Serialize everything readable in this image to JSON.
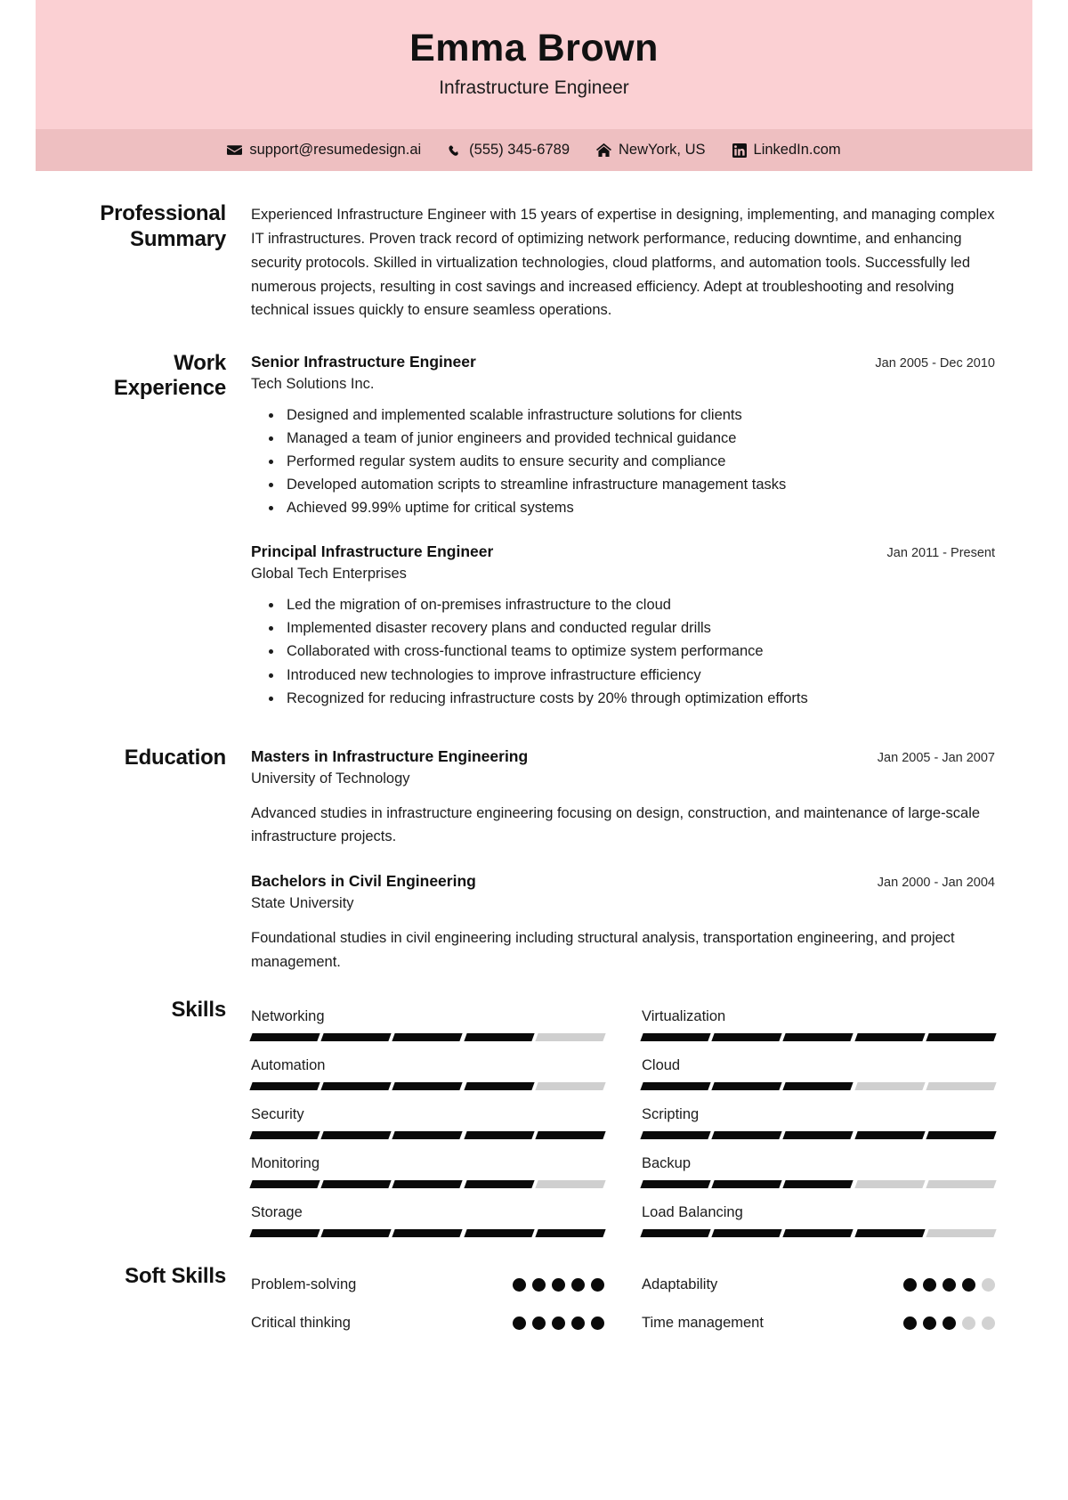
{
  "header": {
    "name": "Emma Brown",
    "job_title": "Infrastructure Engineer",
    "bg_color": "#fbd0d3",
    "contactbar_color": "#eebfc1",
    "contacts": [
      {
        "icon": "envelope-icon",
        "text": "support@resumedesign.ai"
      },
      {
        "icon": "phone-icon",
        "text": "(555) 345-6789"
      },
      {
        "icon": "home-icon",
        "text": "NewYork, US"
      },
      {
        "icon": "linkedin-icon",
        "text": "LinkedIn.com"
      }
    ]
  },
  "summary": {
    "label": "Professional Summary",
    "text": "Experienced Infrastructure Engineer with 15 years of expertise in designing, implementing, and managing complex IT infrastructures. Proven track record of optimizing network performance, reducing downtime, and enhancing security protocols. Skilled in virtualization technologies, cloud platforms, and automation tools. Successfully led numerous projects, resulting in cost savings and increased efficiency. Adept at troubleshooting and resolving technical issues quickly to ensure seamless operations."
  },
  "work": {
    "label": "Work Experience",
    "entries": [
      {
        "role": "Senior Infrastructure Engineer",
        "org": "Tech Solutions Inc.",
        "date": "Jan 2005 - Dec 2010",
        "bullets": [
          "Designed and implemented scalable infrastructure solutions for clients",
          "Managed a team of junior engineers and provided technical guidance",
          "Performed regular system audits to ensure security and compliance",
          "Developed automation scripts to streamline infrastructure management tasks",
          "Achieved 99.99% uptime for critical systems"
        ]
      },
      {
        "role": "Principal Infrastructure Engineer",
        "org": "Global Tech Enterprises",
        "date": "Jan 2011 - Present",
        "bullets": [
          "Led the migration of on-premises infrastructure to the cloud",
          "Implemented disaster recovery plans and conducted regular drills",
          "Collaborated with cross-functional teams to optimize system performance",
          "Introduced new technologies to improve infrastructure efficiency",
          "Recognized for reducing infrastructure costs by 20% through optimization efforts"
        ]
      }
    ]
  },
  "education": {
    "label": "Education",
    "entries": [
      {
        "degree": "Masters in Infrastructure Engineering",
        "school": "University of Technology",
        "date": "Jan 2005 - Jan 2007",
        "description": "Advanced studies in infrastructure engineering focusing on design, construction, and maintenance of large-scale infrastructure projects."
      },
      {
        "degree": "Bachelors in Civil Engineering",
        "school": "State University",
        "date": "Jan 2000 - Jan 2004",
        "description": "Foundational studies in civil engineering including structural analysis, transportation engineering, and project management."
      }
    ]
  },
  "skills": {
    "label": "Skills",
    "max": 5,
    "filled_color": "#0a0a0a",
    "empty_color": "#cfcfcf",
    "items": [
      {
        "name": "Networking",
        "level": 4
      },
      {
        "name": "Virtualization",
        "level": 5
      },
      {
        "name": "Automation",
        "level": 4
      },
      {
        "name": "Cloud",
        "level": 3
      },
      {
        "name": "Security",
        "level": 5
      },
      {
        "name": "Scripting",
        "level": 5
      },
      {
        "name": "Monitoring",
        "level": 4
      },
      {
        "name": "Backup",
        "level": 3
      },
      {
        "name": "Storage",
        "level": 5
      },
      {
        "name": "Load Balancing",
        "level": 4
      }
    ]
  },
  "soft_skills": {
    "label": "Soft Skills",
    "max": 5,
    "items": [
      {
        "name": "Problem-solving",
        "level": 5
      },
      {
        "name": "Adaptability",
        "level": 4
      },
      {
        "name": "Critical thinking",
        "level": 5
      },
      {
        "name": "Time management",
        "level": 3
      }
    ]
  }
}
